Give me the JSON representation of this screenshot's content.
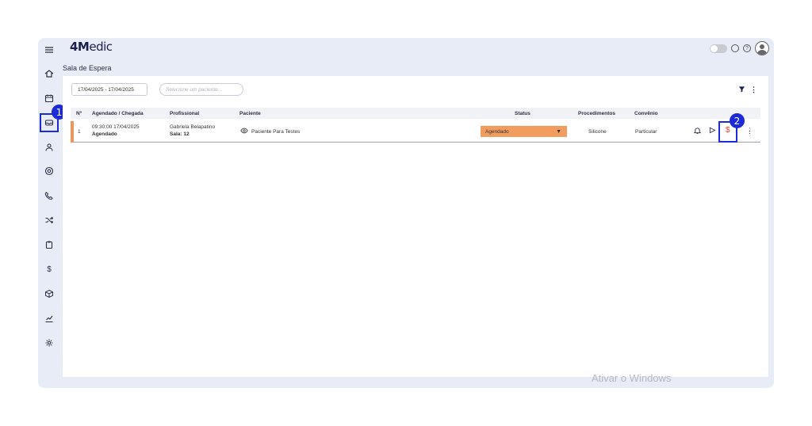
{
  "app": {
    "logo_bold": "4M",
    "logo_light": "edic"
  },
  "page": {
    "title": "Sala de Espera"
  },
  "filters": {
    "date_range": "17/04/2025 - 17/04/2025",
    "search_placeholder": "Selecione um paciente..."
  },
  "table": {
    "headers": {
      "num": "Nº",
      "scheduled": "Agendado / Chegada",
      "professional": "Profissional",
      "patient": "Paciente",
      "status": "Status",
      "procedures": "Procedimentos",
      "insurance": "Convênio"
    },
    "rows": [
      {
        "num": "1",
        "datetime": "09:30:00 17/04/2025",
        "scheduled_state": "Agendado",
        "professional": "Gabriela Belapatino",
        "room": "Sala: 12",
        "patient": "Paciente Para Testes",
        "status": "Agendado",
        "procedure": "Silicone",
        "insurance": "Particular"
      }
    ]
  },
  "annotations": {
    "badge_1": "1",
    "badge_2": "2"
  },
  "watermark": "Ativar o Windows",
  "colors": {
    "accent": "#1d2ad8",
    "status_orange": "#f39c5f",
    "row_accent": "#f1945a",
    "dollar_red": "#e0462e"
  },
  "icons": {
    "sidebar": [
      "menu-icon",
      "home-icon",
      "calendar-icon",
      "waiting-room-icon",
      "users-icon",
      "at-icon",
      "phone-icon",
      "shuffle-icon",
      "clipboard-icon",
      "dollar-icon",
      "box-icon",
      "chart-icon",
      "settings-icon"
    ]
  }
}
